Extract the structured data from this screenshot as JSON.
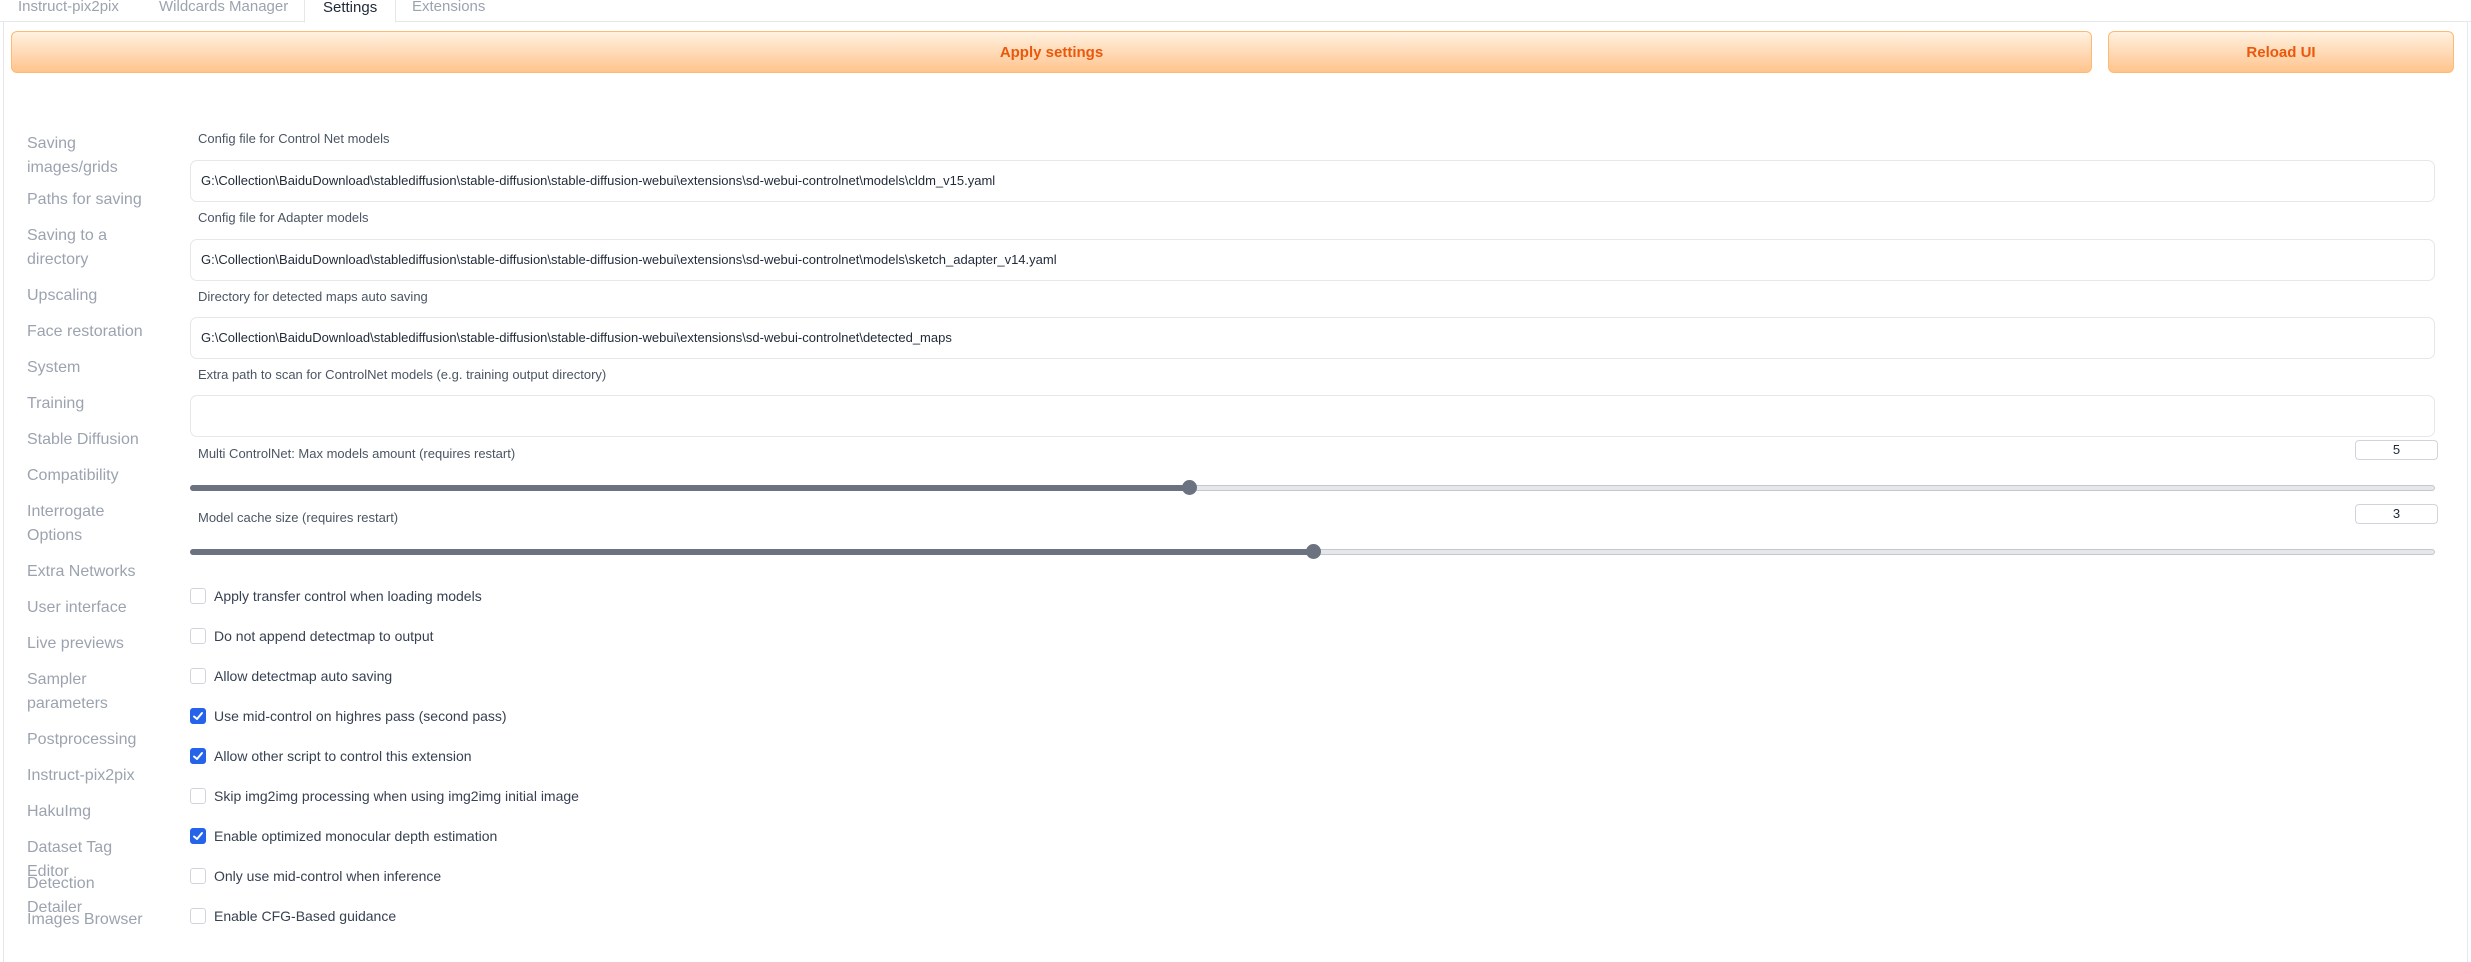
{
  "tabs": [
    {
      "label": "Instruct-pix2pix",
      "active": false
    },
    {
      "label": "Wildcards Manager",
      "active": false
    },
    {
      "label": "Settings",
      "active": true
    },
    {
      "label": "Extensions",
      "active": false
    }
  ],
  "toolbar": {
    "apply_label": "Apply settings",
    "reload_label": "Reload UI"
  },
  "sidebar": {
    "items": [
      {
        "label": "Saving images/grids"
      },
      {
        "label": "Paths for saving"
      },
      {
        "label": "Saving to a directory"
      },
      {
        "label": "Upscaling"
      },
      {
        "label": "Face restoration"
      },
      {
        "label": "System"
      },
      {
        "label": "Training"
      },
      {
        "label": "Stable Diffusion"
      },
      {
        "label": "Compatibility"
      },
      {
        "label": "Interrogate Options"
      },
      {
        "label": "Extra Networks"
      },
      {
        "label": "User interface"
      },
      {
        "label": "Live previews"
      },
      {
        "label": "Sampler parameters"
      },
      {
        "label": "Postprocessing"
      },
      {
        "label": "Instruct-pix2pix"
      },
      {
        "label": "HakuImg"
      },
      {
        "label": "Dataset Tag Editor"
      },
      {
        "label": "Detection Detailer"
      },
      {
        "label": "Images Browser"
      }
    ]
  },
  "settings": {
    "config_cn": {
      "label": "Config file for Control Net models",
      "value": "G:\\Collection\\BaiduDownload\\stablediffusion\\stable-diffusion\\stable-diffusion-webui\\extensions\\sd-webui-controlnet\\models\\cldm_v15.yaml"
    },
    "config_adapter": {
      "label": "Config file for Adapter models",
      "value": "G:\\Collection\\BaiduDownload\\stablediffusion\\stable-diffusion\\stable-diffusion-webui\\extensions\\sd-webui-controlnet\\models\\sketch_adapter_v14.yaml"
    },
    "detected_dir": {
      "label": "Directory for detected maps auto saving",
      "value": "G:\\Collection\\BaiduDownload\\stablediffusion\\stable-diffusion\\stable-diffusion-webui\\extensions\\sd-webui-controlnet\\detected_maps"
    },
    "extra_path": {
      "label": "Extra path to scan for ControlNet models (e.g. training output directory)",
      "value": ""
    },
    "multi_cn": {
      "label": "Multi ControlNet: Max models amount (requires restart)",
      "value": "5",
      "fraction": 0.445
    },
    "cache_size": {
      "label": "Model cache size (requires restart)",
      "value": "3",
      "fraction": 0.5
    },
    "checkboxes": [
      {
        "label": "Apply transfer control when loading models",
        "checked": false
      },
      {
        "label": "Do not append detectmap to output",
        "checked": false
      },
      {
        "label": "Allow detectmap auto saving",
        "checked": false
      },
      {
        "label": "Use mid-control on highres pass (second pass)",
        "checked": true
      },
      {
        "label": "Allow other script to control this extension",
        "checked": true
      },
      {
        "label": "Skip img2img processing when using img2img initial image",
        "checked": false
      },
      {
        "label": "Enable optimized monocular depth estimation",
        "checked": true
      },
      {
        "label": "Only use mid-control when inference",
        "checked": false
      },
      {
        "label": "Enable CFG-Based guidance",
        "checked": false
      }
    ]
  },
  "colors": {
    "accent_orange": "#ea580c",
    "checkbox_blue": "#2563eb",
    "slider_fill": "#6b7280"
  }
}
